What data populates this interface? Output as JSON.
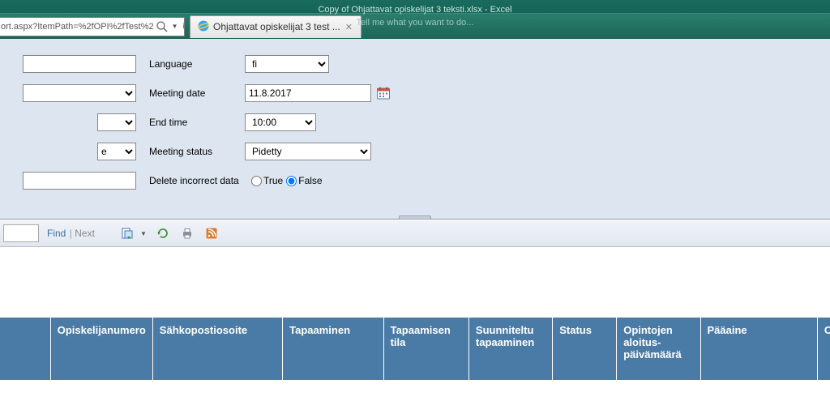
{
  "window": {
    "title_line1": "Copy of Ohjattavat opiskelijat 3 teksti.xlsx - Excel",
    "title_line2": "Tell me what you want to do..."
  },
  "browser": {
    "url_fragment": "ort.aspx?ItemPath=%2fOPI%2fTest%2",
    "tab_title": "Ohjattavat opiskelijat 3 test ..."
  },
  "params": {
    "left_values": {
      "v1": "",
      "v2": "",
      "v3": "",
      "v4": "e",
      "v5": ""
    },
    "language_label": "Language",
    "language_value": "fi",
    "meeting_date_label": "Meeting date",
    "meeting_date_value": "11.8.2017",
    "end_time_label": "End time",
    "end_time_value": "10:00",
    "meeting_status_label": "Meeting status",
    "meeting_status_value": "Pidetty",
    "delete_label": "Delete incorrect data",
    "delete_true": "True",
    "delete_false": "False"
  },
  "toolbar": {
    "find_label": "Find",
    "next_label": "Next"
  },
  "table": {
    "headers": [
      "",
      "Opiskelijanumero",
      "Sähkopostiosoite",
      "Tapaaminen",
      "Tapaamisen tila",
      "Suunniteltu tapaaminen",
      "Status",
      "Opintojen aloitus-päivämäärä",
      "Pääaine",
      "O"
    ]
  }
}
